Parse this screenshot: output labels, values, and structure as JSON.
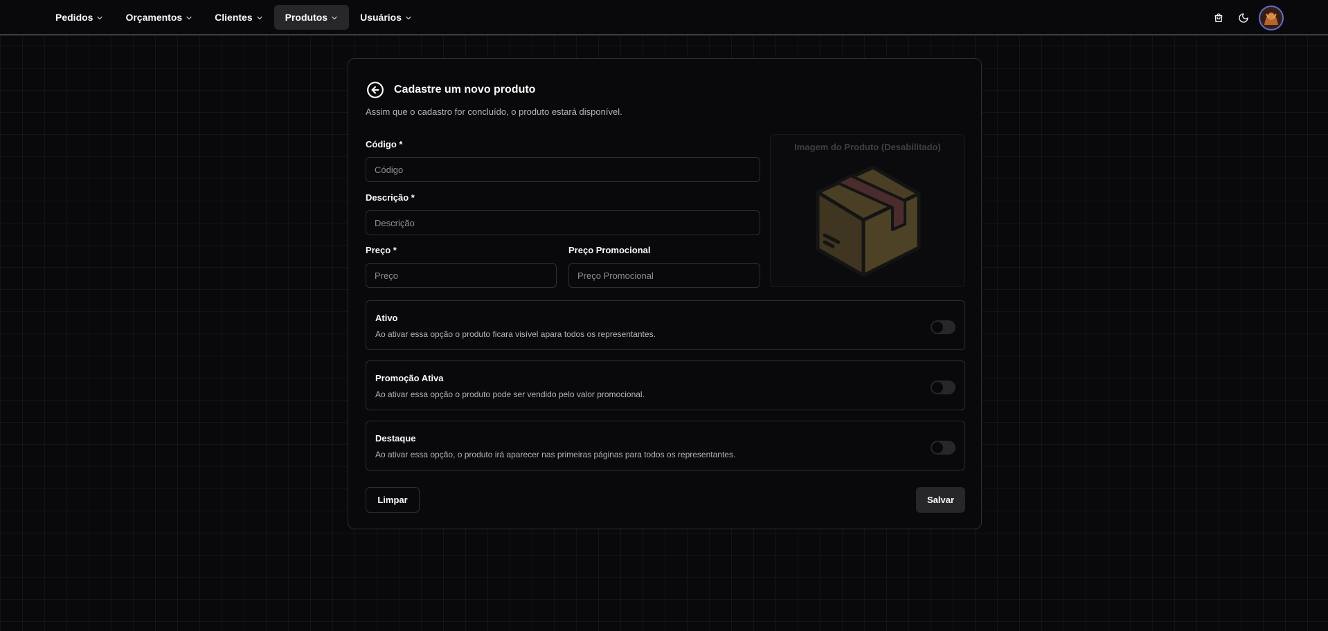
{
  "nav": {
    "items": [
      {
        "label": "Pedidos",
        "active": false
      },
      {
        "label": "Orçamentos",
        "active": false
      },
      {
        "label": "Clientes",
        "active": false
      },
      {
        "label": "Produtos",
        "active": true
      },
      {
        "label": "Usuários",
        "active": false
      }
    ],
    "icons": [
      "shopping-bag-icon",
      "moon-icon",
      "avatar"
    ]
  },
  "form": {
    "title": "Cadastre um novo produto",
    "subtitle": "Assim que o cadastro for concluído, o produto estará disponível.",
    "fields": {
      "codigo": {
        "label": "Código *",
        "placeholder": "Código",
        "value": ""
      },
      "descricao": {
        "label": "Descrição *",
        "placeholder": "Descrição",
        "value": ""
      },
      "preco": {
        "label": "Preço *",
        "placeholder": "Preço",
        "value": ""
      },
      "preco_promocional": {
        "label": "Preço Promocional",
        "placeholder": "Preço Promocional",
        "value": ""
      }
    },
    "image": {
      "caption": "Imagem do Produto (Desabilitado)"
    },
    "toggles": [
      {
        "title": "Ativo",
        "description": "Ao ativar essa opção o produto ficara visível apara todos os representantes.",
        "checked": false
      },
      {
        "title": "Promoção Ativa",
        "description": "Ao ativar essa opção o produto pode ser vendido pelo valor promocional.",
        "checked": false
      },
      {
        "title": "Destaque",
        "description": "Ao ativar essa opção, o produto irá aparecer nas primeiras páginas para todos os representantes.",
        "checked": false
      }
    ],
    "buttons": {
      "clear": "Limpar",
      "save": "Salvar"
    }
  },
  "colors": {
    "background": "#09090b",
    "border": "#2e2e33",
    "muted_text": "#b5b5bb",
    "active_nav": "#27272a"
  }
}
